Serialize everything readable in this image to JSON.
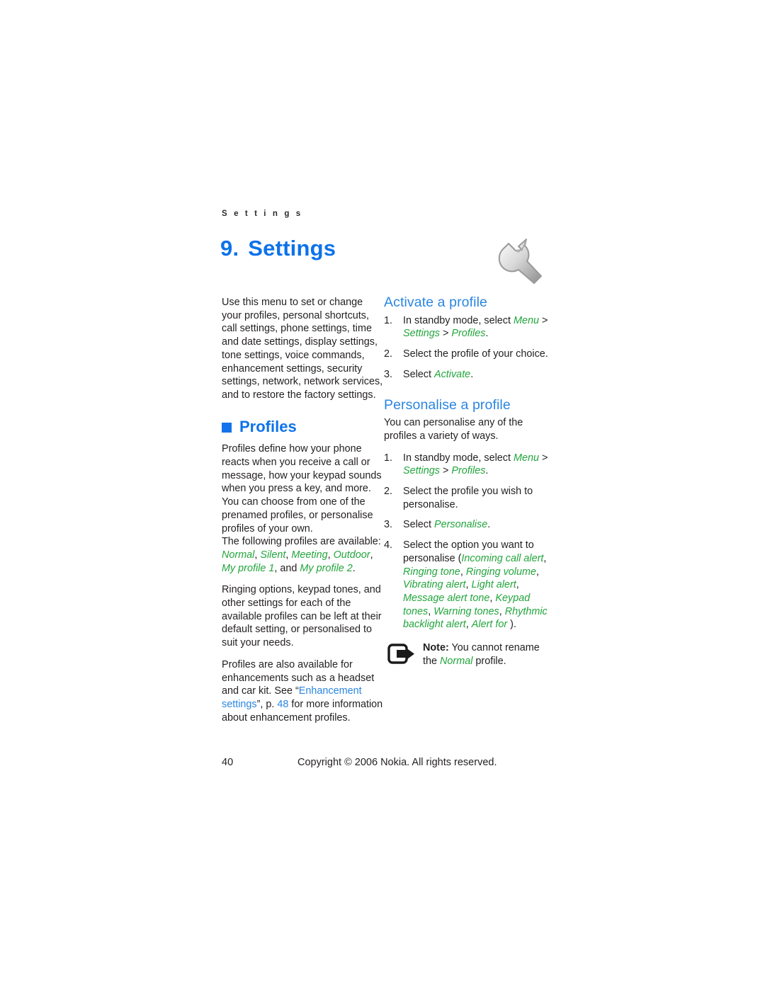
{
  "page": {
    "running_head": "S e t t i n g s",
    "chapter_number": "9.",
    "chapter_title": "Settings",
    "chapter_icon": "wrench-icon",
    "footer_page_number": "40",
    "footer_copyright": "Copyright © 2006 Nokia. All rights reserved."
  },
  "colors": {
    "heading_blue": "#0d72ea",
    "subhead_blue": "#2a86e0",
    "bullet_blue": "#1273ea",
    "ui_term_green": "#22a53c",
    "link_blue": "#2a86e0",
    "body_text": "#231f20"
  },
  "left_column": {
    "intro": "Use this menu to set or change your profiles, personal shortcuts, call settings, phone settings, time and date settings, display settings, tone settings, voice commands, enhancement settings, security settings, network, network services, and to restore the factory settings.",
    "section_heading": "Profiles",
    "para1_a": "Profiles define how your phone reacts when you receive a call or message, how your keypad sounds when you press a key, and more. You can choose from one of the prenamed profiles, or personalise profiles of your own.",
    "para1_b": "The following profiles are available: ",
    "profile_list": {
      "item1": "Normal",
      "sep1": ", ",
      "item2": "Silent",
      "sep2": ", ",
      "item3": "Meeting",
      "sep3": ", ",
      "item4": "Outdoor",
      "sep4": ", ",
      "item5": "My profile 1",
      "sep5": ", and ",
      "item6": "My profile 2",
      "end": "."
    },
    "para2": "Ringing options, keypad tones, and other settings for each of the available profiles can be left at their default setting, or personalised to suit your needs.",
    "para3_a": "Profiles are also available for enhancements such as a headset and car kit. See “",
    "para3_link": "Enhancement settings",
    "para3_b": "”, p. ",
    "para3_page": "48",
    "para3_c": " for more information about enhancement profiles."
  },
  "right_column": {
    "activate": {
      "heading": "Activate a profile",
      "steps": [
        {
          "marker": "1.",
          "text_a": "In standby mode, select ",
          "ui1": "Menu",
          "sep1": " > ",
          "ui2": "Settings",
          "sep2": " > ",
          "ui3": "Profiles",
          "text_b": "."
        },
        {
          "marker": "2.",
          "text_a": "Select the profile of your choice.",
          "ui1": "",
          "text_b": ""
        },
        {
          "marker": "3.",
          "text_a": "Select ",
          "ui1": "Activate",
          "text_b": "."
        }
      ]
    },
    "personalise": {
      "heading": "Personalise a profile",
      "intro": "You can personalise any of the profiles a variety of ways.",
      "steps": [
        {
          "marker": "1.",
          "text_a": "In standby mode, select ",
          "ui1": "Menu",
          "sep1": " > ",
          "ui2": "Settings",
          "sep2": " > ",
          "ui3": "Profiles",
          "text_b": "."
        },
        {
          "marker": "2.",
          "text_a": "Select the profile you wish to personalise.",
          "ui1": "",
          "text_b": ""
        },
        {
          "marker": "3.",
          "text_a": "Select ",
          "ui1": "Personalise",
          "text_b": "."
        }
      ],
      "step4": {
        "marker": "4.",
        "text_a": "Select the option you want to personalise (",
        "options": {
          "o1": "Incoming call alert",
          "s1": ", ",
          "o2": "Ringing tone",
          "s2": ", ",
          "o3": "Ringing volume",
          "s3": ", ",
          "o4": "Vibrating alert",
          "s4": ", ",
          "o5": "Light alert",
          "s5": ", ",
          "o6": "Message alert tone",
          "s6": ", ",
          "o7": "Keypad tones",
          "s7": ", ",
          "o8": "Warning tones",
          "s8": ", ",
          "o9": "Rhythmic backlight alert",
          "s9": ", ",
          "o10": "Alert for"
        },
        "text_b": " )."
      }
    },
    "note": {
      "icon": "note-arrow-icon",
      "label": "Note:",
      "text_a": " You cannot rename the ",
      "ui1": "Normal",
      "text_b": " profile."
    }
  }
}
